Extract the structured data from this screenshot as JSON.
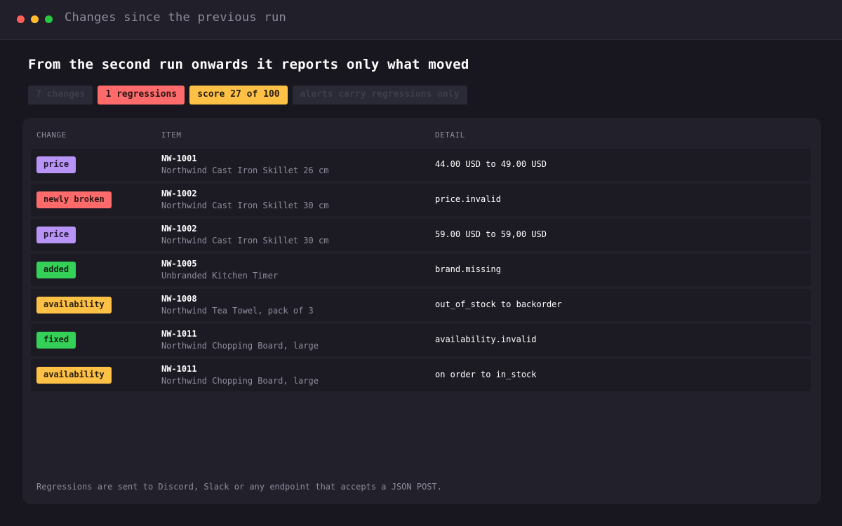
{
  "window": {
    "title": "Changes since the previous run"
  },
  "headline": "From the second run onwards it reports only what moved",
  "chips": [
    {
      "label": "7 changes",
      "style": "muted"
    },
    {
      "label": "1 regressions",
      "style": "red"
    },
    {
      "label": "score 27 of 100",
      "style": "amber"
    },
    {
      "label": "alerts carry regressions only",
      "style": "muted"
    }
  ],
  "table": {
    "columns": {
      "change": "CHANGE",
      "item": "ITEM",
      "detail": "DETAIL"
    },
    "rows": [
      {
        "change": "price",
        "color": "purple",
        "id": "NW-1001",
        "name": "Northwind Cast Iron Skillet 26 cm",
        "detail": "44.00 USD to 49.00 USD"
      },
      {
        "change": "newly broken",
        "color": "red",
        "id": "NW-1002",
        "name": "Northwind Cast Iron Skillet 30 cm",
        "detail": "price.invalid"
      },
      {
        "change": "price",
        "color": "purple",
        "id": "NW-1002",
        "name": "Northwind Cast Iron Skillet 30 cm",
        "detail": "59.00 USD to 59,00 USD"
      },
      {
        "change": "added",
        "color": "green",
        "id": "NW-1005",
        "name": "Unbranded Kitchen Timer",
        "detail": "brand.missing"
      },
      {
        "change": "availability",
        "color": "amber",
        "id": "NW-1008",
        "name": "Northwind Tea Towel, pack of 3",
        "detail": "out_of_stock to backorder"
      },
      {
        "change": "fixed",
        "color": "green",
        "id": "NW-1011",
        "name": "Northwind Chopping Board, large",
        "detail": "availability.invalid"
      },
      {
        "change": "availability",
        "color": "amber",
        "id": "NW-1011",
        "name": "Northwind Chopping Board, large",
        "detail": "on order to in_stock"
      }
    ]
  },
  "footer": "Regressions are sent to Discord, Slack or any endpoint that accepts a JSON POST.",
  "colors": {
    "background": "#18171f",
    "panel": "#21202b",
    "purple": "#b794f6",
    "red": "#ff6b6b",
    "green": "#34d058",
    "amber": "#ffc145"
  }
}
